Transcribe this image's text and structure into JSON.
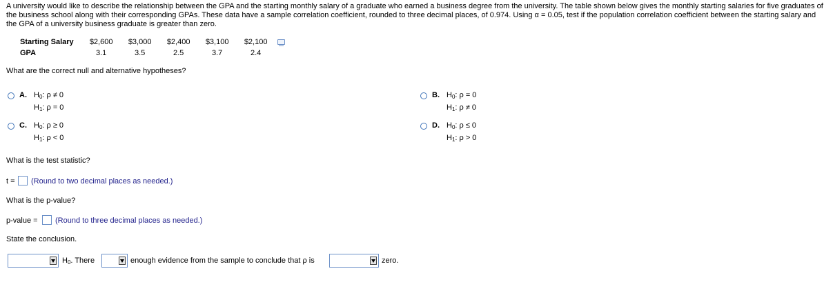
{
  "problem_text": "A university would like to describe the relationship between the GPA and the starting monthly salary of a graduate who earned a business degree from the university. The table shown below gives the monthly starting salaries for five graduates of the business school along with their corresponding GPAs. These data have a sample correlation coefficient, rounded to three decimal places, of 0.974. Using α = 0.05, test if the population correlation coefficient between the starting salary and the GPA of a university business graduate is greater than zero.",
  "table": {
    "row1_label": "Starting Salary",
    "row1": [
      "$2,600",
      "$3,000",
      "$2,400",
      "$3,100",
      "$2,100"
    ],
    "row2_label": "GPA",
    "row2": [
      "3.1",
      "3.5",
      "2.5",
      "3.7",
      "2.4"
    ]
  },
  "icons": {
    "copy": "copy-data-icon",
    "dropdown": "chevron-down-icon"
  },
  "q1": "What are the correct null and alternative hypotheses?",
  "options": {
    "A": {
      "letter": "A.",
      "h0_lead": "H",
      "h0_sub": "0",
      "h0_rel": ": ρ ≠ 0",
      "h1_lead": "H",
      "h1_sub": "1",
      "h1_rel": ": ρ = 0"
    },
    "B": {
      "letter": "B.",
      "h0_lead": "H",
      "h0_sub": "0",
      "h0_rel": ": ρ = 0",
      "h1_lead": "H",
      "h1_sub": "1",
      "h1_rel": ": ρ ≠ 0"
    },
    "C": {
      "letter": "C.",
      "h0_lead": "H",
      "h0_sub": "0",
      "h0_rel": ": ρ ≥ 0",
      "h1_lead": "H",
      "h1_sub": "1",
      "h1_rel": ": ρ < 0"
    },
    "D": {
      "letter": "D.",
      "h0_lead": "H",
      "h0_sub": "0",
      "h0_rel": ": ρ ≤ 0",
      "h1_lead": "H",
      "h1_sub": "1",
      "h1_rel": ": ρ > 0"
    }
  },
  "q2": "What is the test statistic?",
  "t_label": "t =",
  "t_hint": "(Round to two decimal places as needed.)",
  "q3": "What is the p-value?",
  "p_label": "p-value =",
  "p_hint": "(Round to three decimal places as needed.)",
  "q4": "State the conclusion.",
  "conclusion": {
    "h0_lead": "H",
    "h0_sub": "0",
    "h0_after": ". There",
    "middle": "enough evidence from the sample to conclude that ρ is",
    "end": "zero."
  }
}
